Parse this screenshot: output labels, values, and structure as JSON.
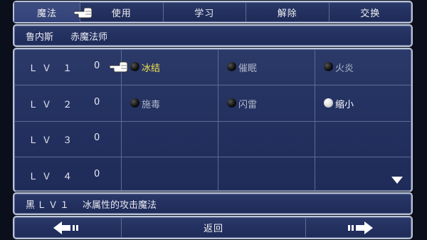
{
  "tabs": [
    {
      "label": "魔法",
      "active": true
    },
    {
      "label": "使用",
      "active": false
    },
    {
      "label": "学习",
      "active": false
    },
    {
      "label": "解除",
      "active": false
    },
    {
      "label": "交换",
      "active": false
    }
  ],
  "character": {
    "name": "鲁内斯",
    "job": "赤魔法师"
  },
  "levels": [
    {
      "lv": "ＬＶ １",
      "count": "0",
      "spells": [
        {
          "name": "冰结",
          "orb": "black",
          "state": "selected"
        },
        {
          "name": "催眠",
          "orb": "black",
          "state": "dim"
        },
        {
          "name": "火炎",
          "orb": "black",
          "state": "dim"
        }
      ]
    },
    {
      "lv": "ＬＶ ２",
      "count": "0",
      "spells": [
        {
          "name": "施毒",
          "orb": "black",
          "state": "dim"
        },
        {
          "name": "闪雷",
          "orb": "black",
          "state": "dim"
        },
        {
          "name": "缩小",
          "orb": "white",
          "state": "bright"
        }
      ]
    },
    {
      "lv": "ＬＶ ３",
      "count": "0",
      "spells": []
    },
    {
      "lv": "ＬＶ ４",
      "count": "0",
      "spells": []
    }
  ],
  "description": {
    "category": "黑ＬＶ１",
    "text": "冰属性的攻击魔法"
  },
  "nav": {
    "back_label": "返回"
  },
  "colors": {
    "panel": "#243262",
    "border": "#b9c2d8",
    "highlight": "#f2e24a"
  }
}
